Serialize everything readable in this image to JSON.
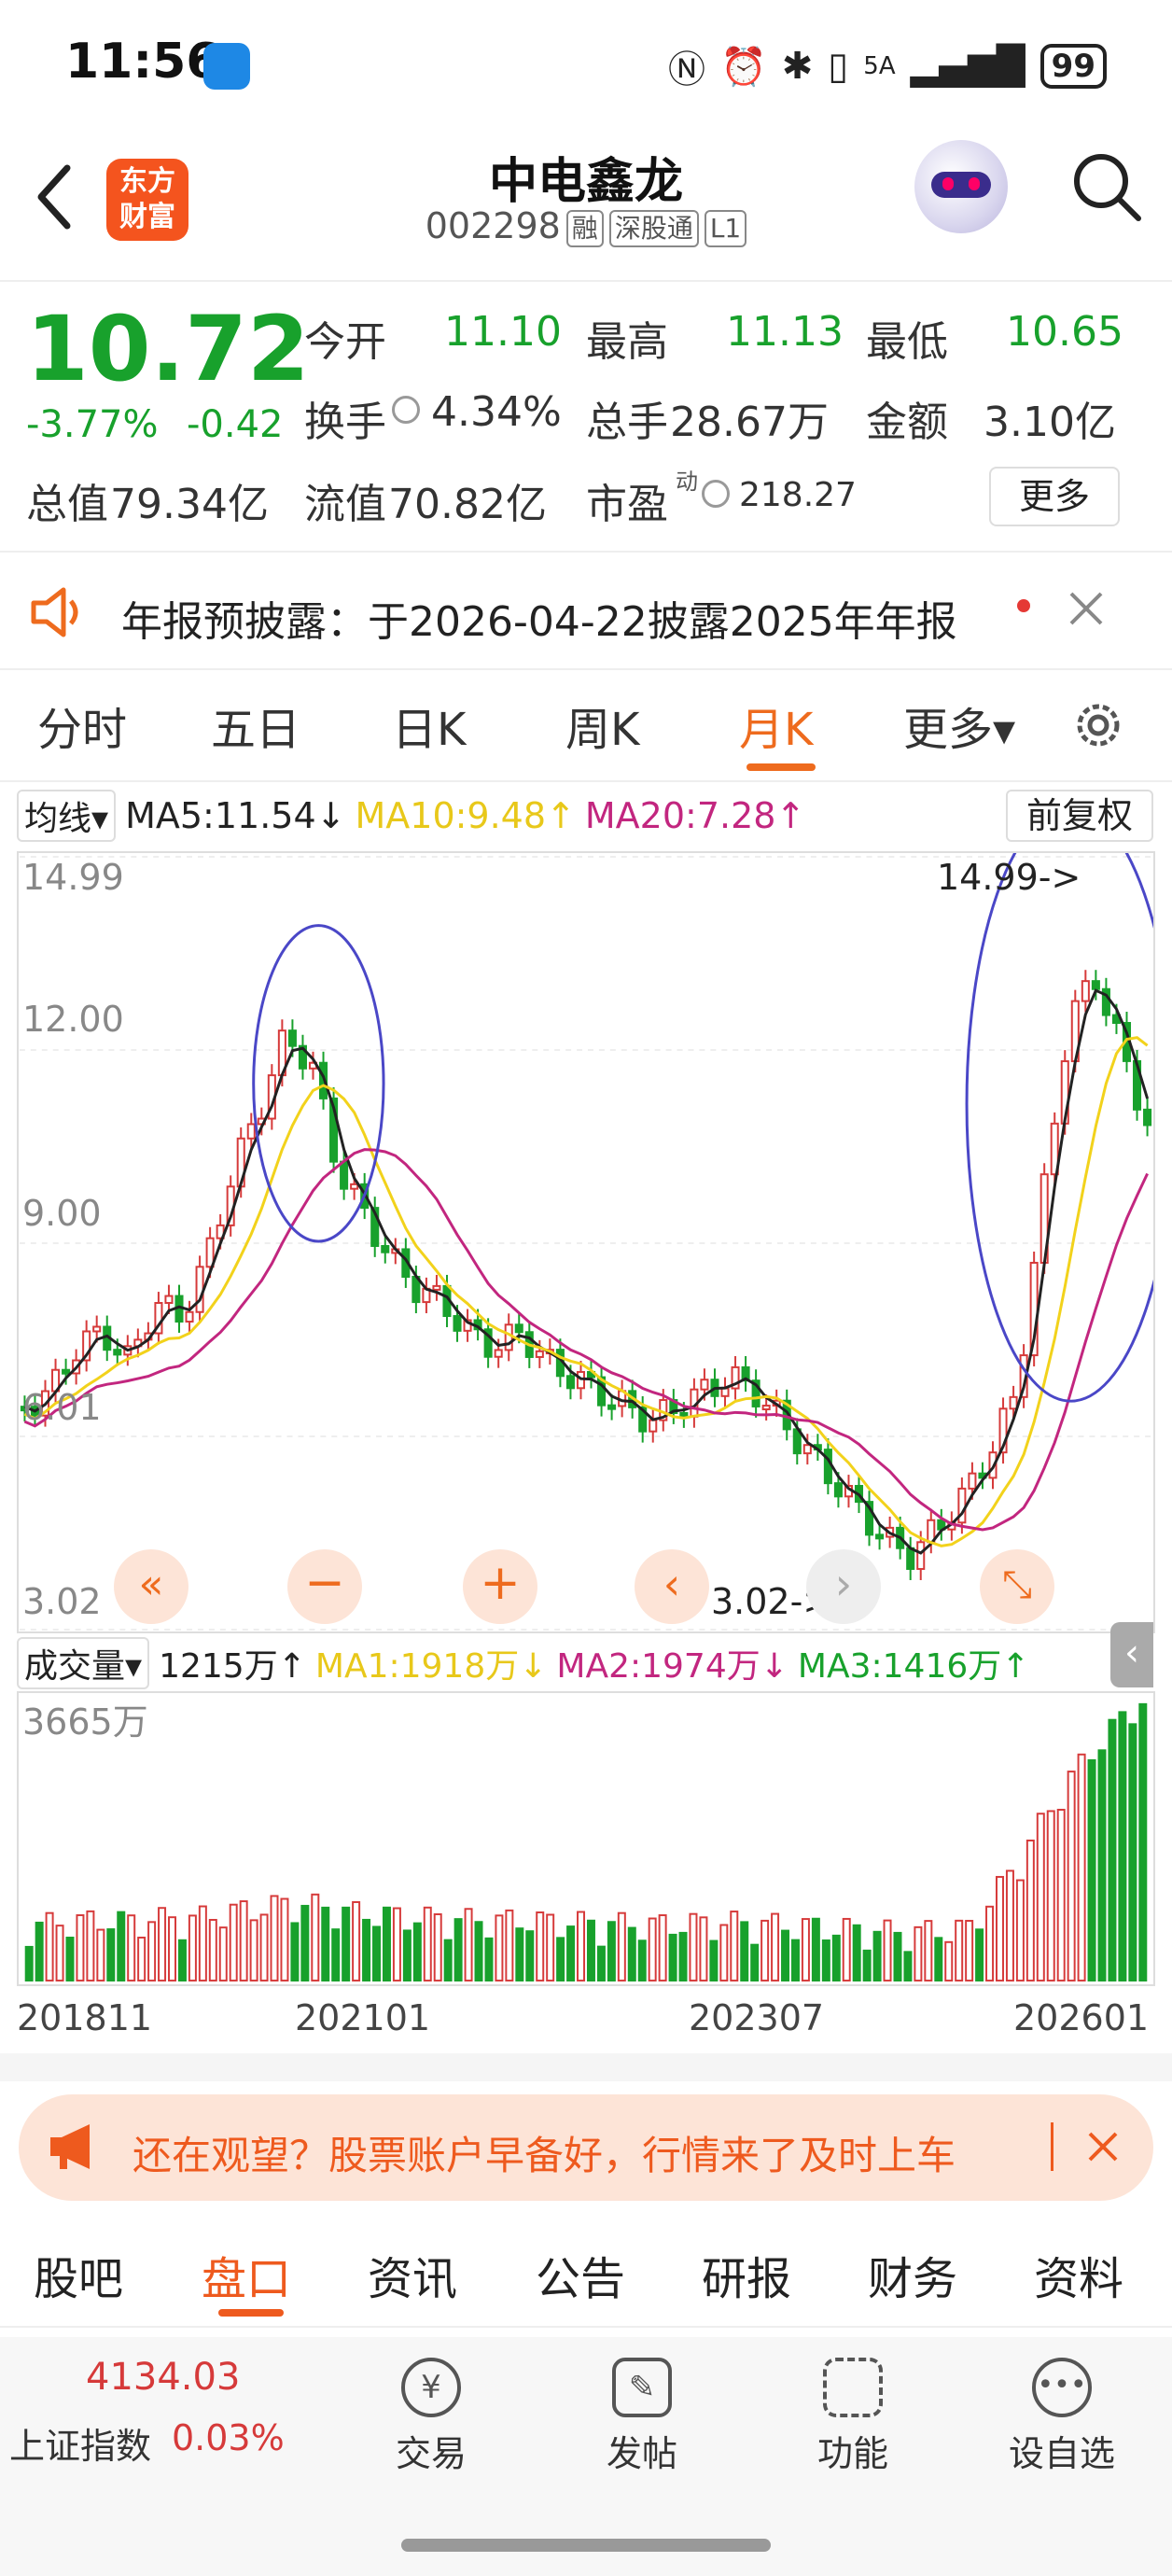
{
  "status_bar": {
    "time": "11:56",
    "network": "5A",
    "battery": "99"
  },
  "header": {
    "logo_line1": "东方",
    "logo_line2": "财富",
    "stock_name": "中电鑫龙",
    "stock_code": "002298",
    "tags": [
      "融",
      "深股通",
      "L1"
    ]
  },
  "quote": {
    "price": "10.72",
    "change_pct": "-3.77%",
    "change": "-0.42",
    "open_label": "今开",
    "open": "11.10",
    "high_label": "最高",
    "high": "11.13",
    "low_label": "最低",
    "low": "10.65",
    "turnover_label": "换手",
    "turnover": "4.34%",
    "volume_label": "总手",
    "volume": "28.67万",
    "amount_label": "金额",
    "amount": "3.10亿",
    "mktcap_label": "总值",
    "mktcap": "79.34亿",
    "float_label": "流值",
    "float": "70.82亿",
    "pe_label": "市盈",
    "pe_sup": "动",
    "pe": "218.27",
    "more": "更多"
  },
  "notice": {
    "text": "年报预披露：于2026-04-22披露2025年年报"
  },
  "period_tabs": [
    "分时",
    "五日",
    "日K",
    "周K",
    "月K",
    "更多▾"
  ],
  "ma_legend": {
    "mode": "均线",
    "ma5": "MA5:11.54↓",
    "ma10": "MA10:9.48↑",
    "ma20": "MA20:7.28↑",
    "adjust": "前复权"
  },
  "price_axis": [
    "14.99",
    "12.00",
    "9.00",
    "6.01",
    "3.02"
  ],
  "annotations": {
    "max_label": "14.99->",
    "min_label": "3.02->"
  },
  "vol_legend": {
    "mode": "成交量",
    "value": "1215万↑",
    "ma1": "MA1:1918万↓",
    "ma2": "MA2:1974万↓",
    "ma3": "MA3:1416万↑",
    "max": "3665万"
  },
  "dates": [
    "201811",
    "202101",
    "202307",
    "202601"
  ],
  "ad": {
    "text": "还在观望？股票账户早备好，行情来了及时上车"
  },
  "bottom_tabs": [
    "股吧",
    "盘口",
    "资讯",
    "公告",
    "研报",
    "财务",
    "资料"
  ],
  "footer": {
    "index_value": "4134.03",
    "index_name": "上证指数",
    "index_change": "0.03%",
    "actions": [
      "交易",
      "发帖",
      "功能",
      "设自选"
    ]
  },
  "colors": {
    "up": "#d63a3a",
    "down": "#18a12c",
    "ma5": "#222222",
    "ma10": "#f2d21b",
    "ma20": "#c2267f",
    "accent": "#ee6b1e"
  },
  "chart_data": {
    "type": "candlestick",
    "ylim": [
      3.02,
      14.99
    ],
    "yticks": [
      14.99,
      12.0,
      9.0,
      6.01,
      3.02
    ],
    "xticks": [
      "201811",
      "202101",
      "202307",
      "202601"
    ],
    "highest": 14.99,
    "lowest": 3.02,
    "ma_latest": {
      "MA5": 11.54,
      "MA10": 9.48,
      "MA20": 7.28
    },
    "volume_max_label": "3665万",
    "volume_latest": "1215万"
  }
}
